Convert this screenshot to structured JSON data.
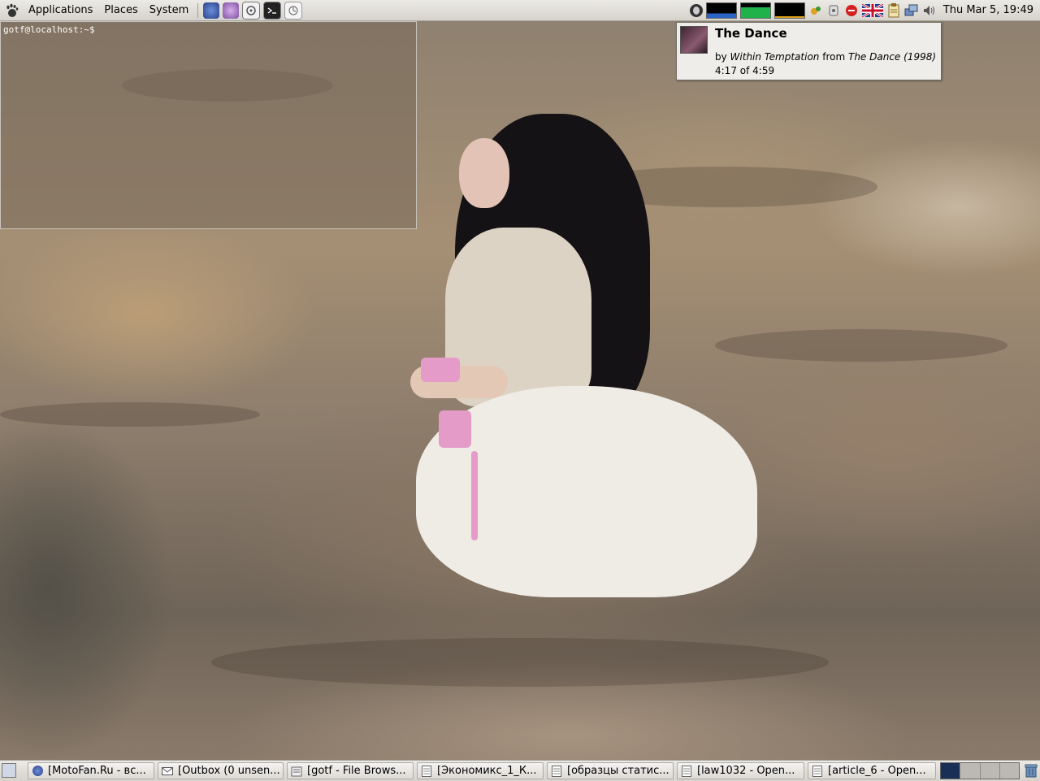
{
  "top_panel": {
    "menus": [
      "Applications",
      "Places",
      "System"
    ],
    "launchers": [
      "firefox-icon",
      "pidgin-icon",
      "rhythmbox-icon",
      "terminal-icon",
      "evolution-icon"
    ],
    "tray_icons": [
      "moon-icon",
      "network-icon",
      "ssh-icon",
      "stop-icon",
      "uk-flag-icon",
      "clipboard-icon",
      "desktop-switch-icon",
      "volume-icon"
    ],
    "clock": "Thu Mar  5, 19:49"
  },
  "terminal": {
    "prompt": "gotf@localhost:~$"
  },
  "notification": {
    "title": "The Dance",
    "by_label": "by",
    "artist": "Within Temptation",
    "from_label": "from",
    "album": "The Dance (1998)",
    "progress": "4:17 of 4:59",
    "progress_fraction": 0.86
  },
  "taskbar": {
    "tasks": [
      {
        "label": "[MotoFan.Ru - вс...",
        "icon": "firefox-icon"
      },
      {
        "label": "[Outbox (0 unsen...",
        "icon": "mail-icon"
      },
      {
        "label": "[gotf - File Brows...",
        "icon": "folder-icon"
      },
      {
        "label": "[Экономикс_1_К...",
        "icon": "document-icon"
      },
      {
        "label": "[образцы статис...",
        "icon": "document-icon"
      },
      {
        "label": "[law1032 - Open...",
        "icon": "document-icon"
      },
      {
        "label": "[article_6 - Open...",
        "icon": "document-icon"
      }
    ],
    "workspaces": 4,
    "active_workspace": 1
  },
  "colors": {
    "panel": "#e4e1dc",
    "notification_bg": "#efede9",
    "workspace_active": "#1a2f55"
  }
}
